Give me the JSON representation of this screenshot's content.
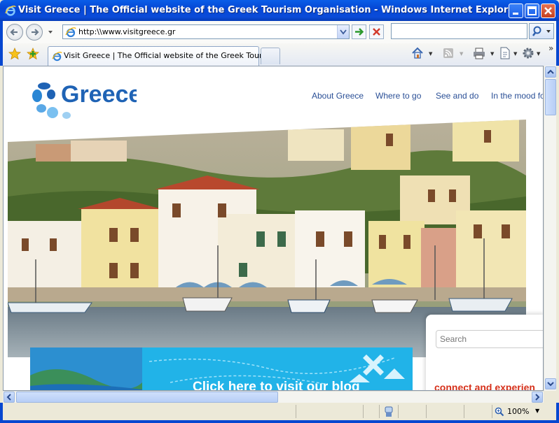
{
  "window": {
    "title": "Visit Greece | The Official website of the Greek Tourism Organisation - Windows Internet Explorer"
  },
  "address_bar": {
    "url": "http:\\\\www.visitgreece.gr"
  },
  "tab": {
    "label": "Visit Greece | The Official website of the Greek Touris..."
  },
  "page": {
    "logo_text": "Greece",
    "nav": [
      "About Greece",
      "Where to go",
      "See and do",
      "In the mood fo"
    ],
    "search_placeholder": "Search",
    "blog_banner": "Click here to visit our blog",
    "connect_heading": "connect and experien"
  },
  "status": {
    "zoom": "100%"
  },
  "colors": {
    "titlebar": "#0a55e0",
    "nav_link": "#2a4f96",
    "accent_red": "#d6311b",
    "logo_blue": "#1f63b5"
  }
}
